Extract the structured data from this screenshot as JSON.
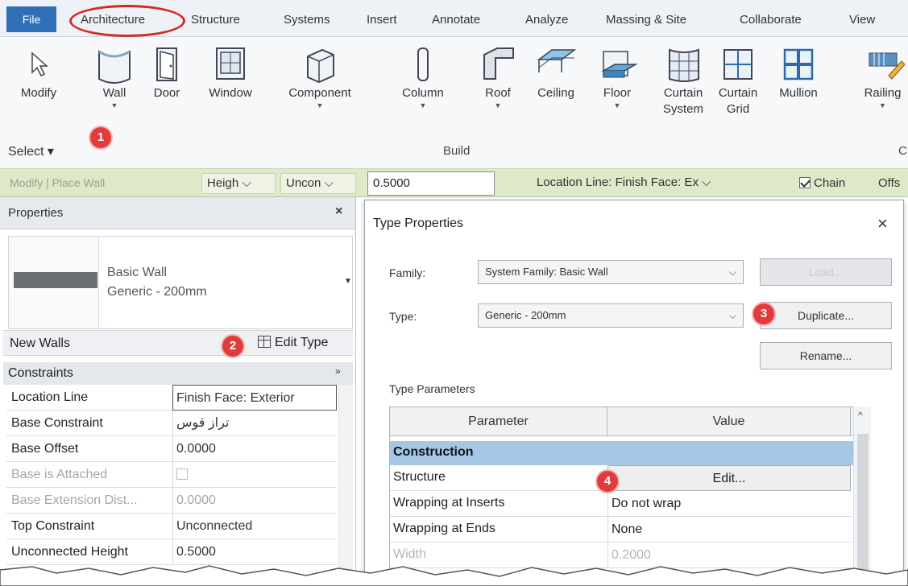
{
  "ribbon": {
    "tabs": [
      "File",
      "Architecture",
      "Structure",
      "Systems",
      "Insert",
      "Annotate",
      "Analyze",
      "Massing & Site",
      "Collaborate",
      "View"
    ],
    "active_tab": "Architecture",
    "tools": {
      "modify": "Modify",
      "wall": "Wall",
      "door": "Door",
      "window": "Window",
      "component": "Component",
      "column": "Column",
      "roof": "Roof",
      "ceiling": "Ceiling",
      "floor": "Floor",
      "curtain_system_1": "Curtain",
      "curtain_system_2": "System",
      "curtain_grid_1": "Curtain",
      "curtain_grid_2": "Grid",
      "mullion": "Mullion",
      "railing": "Railing"
    },
    "select_label": "Select ▾",
    "build_label": "Build",
    "c_label": "C"
  },
  "options_bar": {
    "context": "Modify | Place Wall",
    "height": "Heigh ⌵",
    "unconnected": "Uncon ⌵",
    "value": "0.5000",
    "location_line": "Location Line: Finish Face: Ex ⌵",
    "chain": "Chain",
    "offset": "Offs"
  },
  "properties": {
    "title": "Properties",
    "close": "×",
    "type_name_1": "Basic Wall",
    "type_name_2": "Generic - 200mm",
    "new_walls": "New Walls",
    "edit_type": "Edit Type",
    "constraints": "Constraints",
    "rows": [
      {
        "key": "Location Line",
        "value": "Finish Face: Exterior"
      },
      {
        "key": "Base Constraint",
        "value": "تراز قوس"
      },
      {
        "key": "Base Offset",
        "value": "0.0000"
      },
      {
        "key": "Base is Attached",
        "value": ""
      },
      {
        "key": "Base Extension Dist...",
        "value": "0.0000"
      },
      {
        "key": "Top Constraint",
        "value": "Unconnected"
      },
      {
        "key": "Unconnected Height",
        "value": "0.5000"
      }
    ]
  },
  "type_properties": {
    "title": "Type Properties",
    "close": "×",
    "family_label": "Family:",
    "family_value": "System Family: Basic Wall",
    "type_label": "Type:",
    "type_value": "Generic - 200mm",
    "load": "Load...",
    "duplicate": "Duplicate...",
    "rename": "Rename...",
    "type_parameters": "Type Parameters",
    "col_parameter": "Parameter",
    "col_value": "Value",
    "col_eq": "=",
    "group": "Construction",
    "rows": [
      {
        "key": "Structure",
        "value": "Edit..."
      },
      {
        "key": "Wrapping at Inserts",
        "value": "Do not wrap"
      },
      {
        "key": "Wrapping at Ends",
        "value": "None"
      },
      {
        "key": "Width",
        "value": "0.2000"
      }
    ]
  },
  "badges": [
    "1",
    "2",
    "3",
    "4"
  ],
  "colors": {
    "accent": "#2f6fb6",
    "options_bar": "#dde9c8",
    "group_header": "#a6c6e6",
    "badge": "#e23b3b",
    "highlight_circle": "#cf2b2b"
  }
}
